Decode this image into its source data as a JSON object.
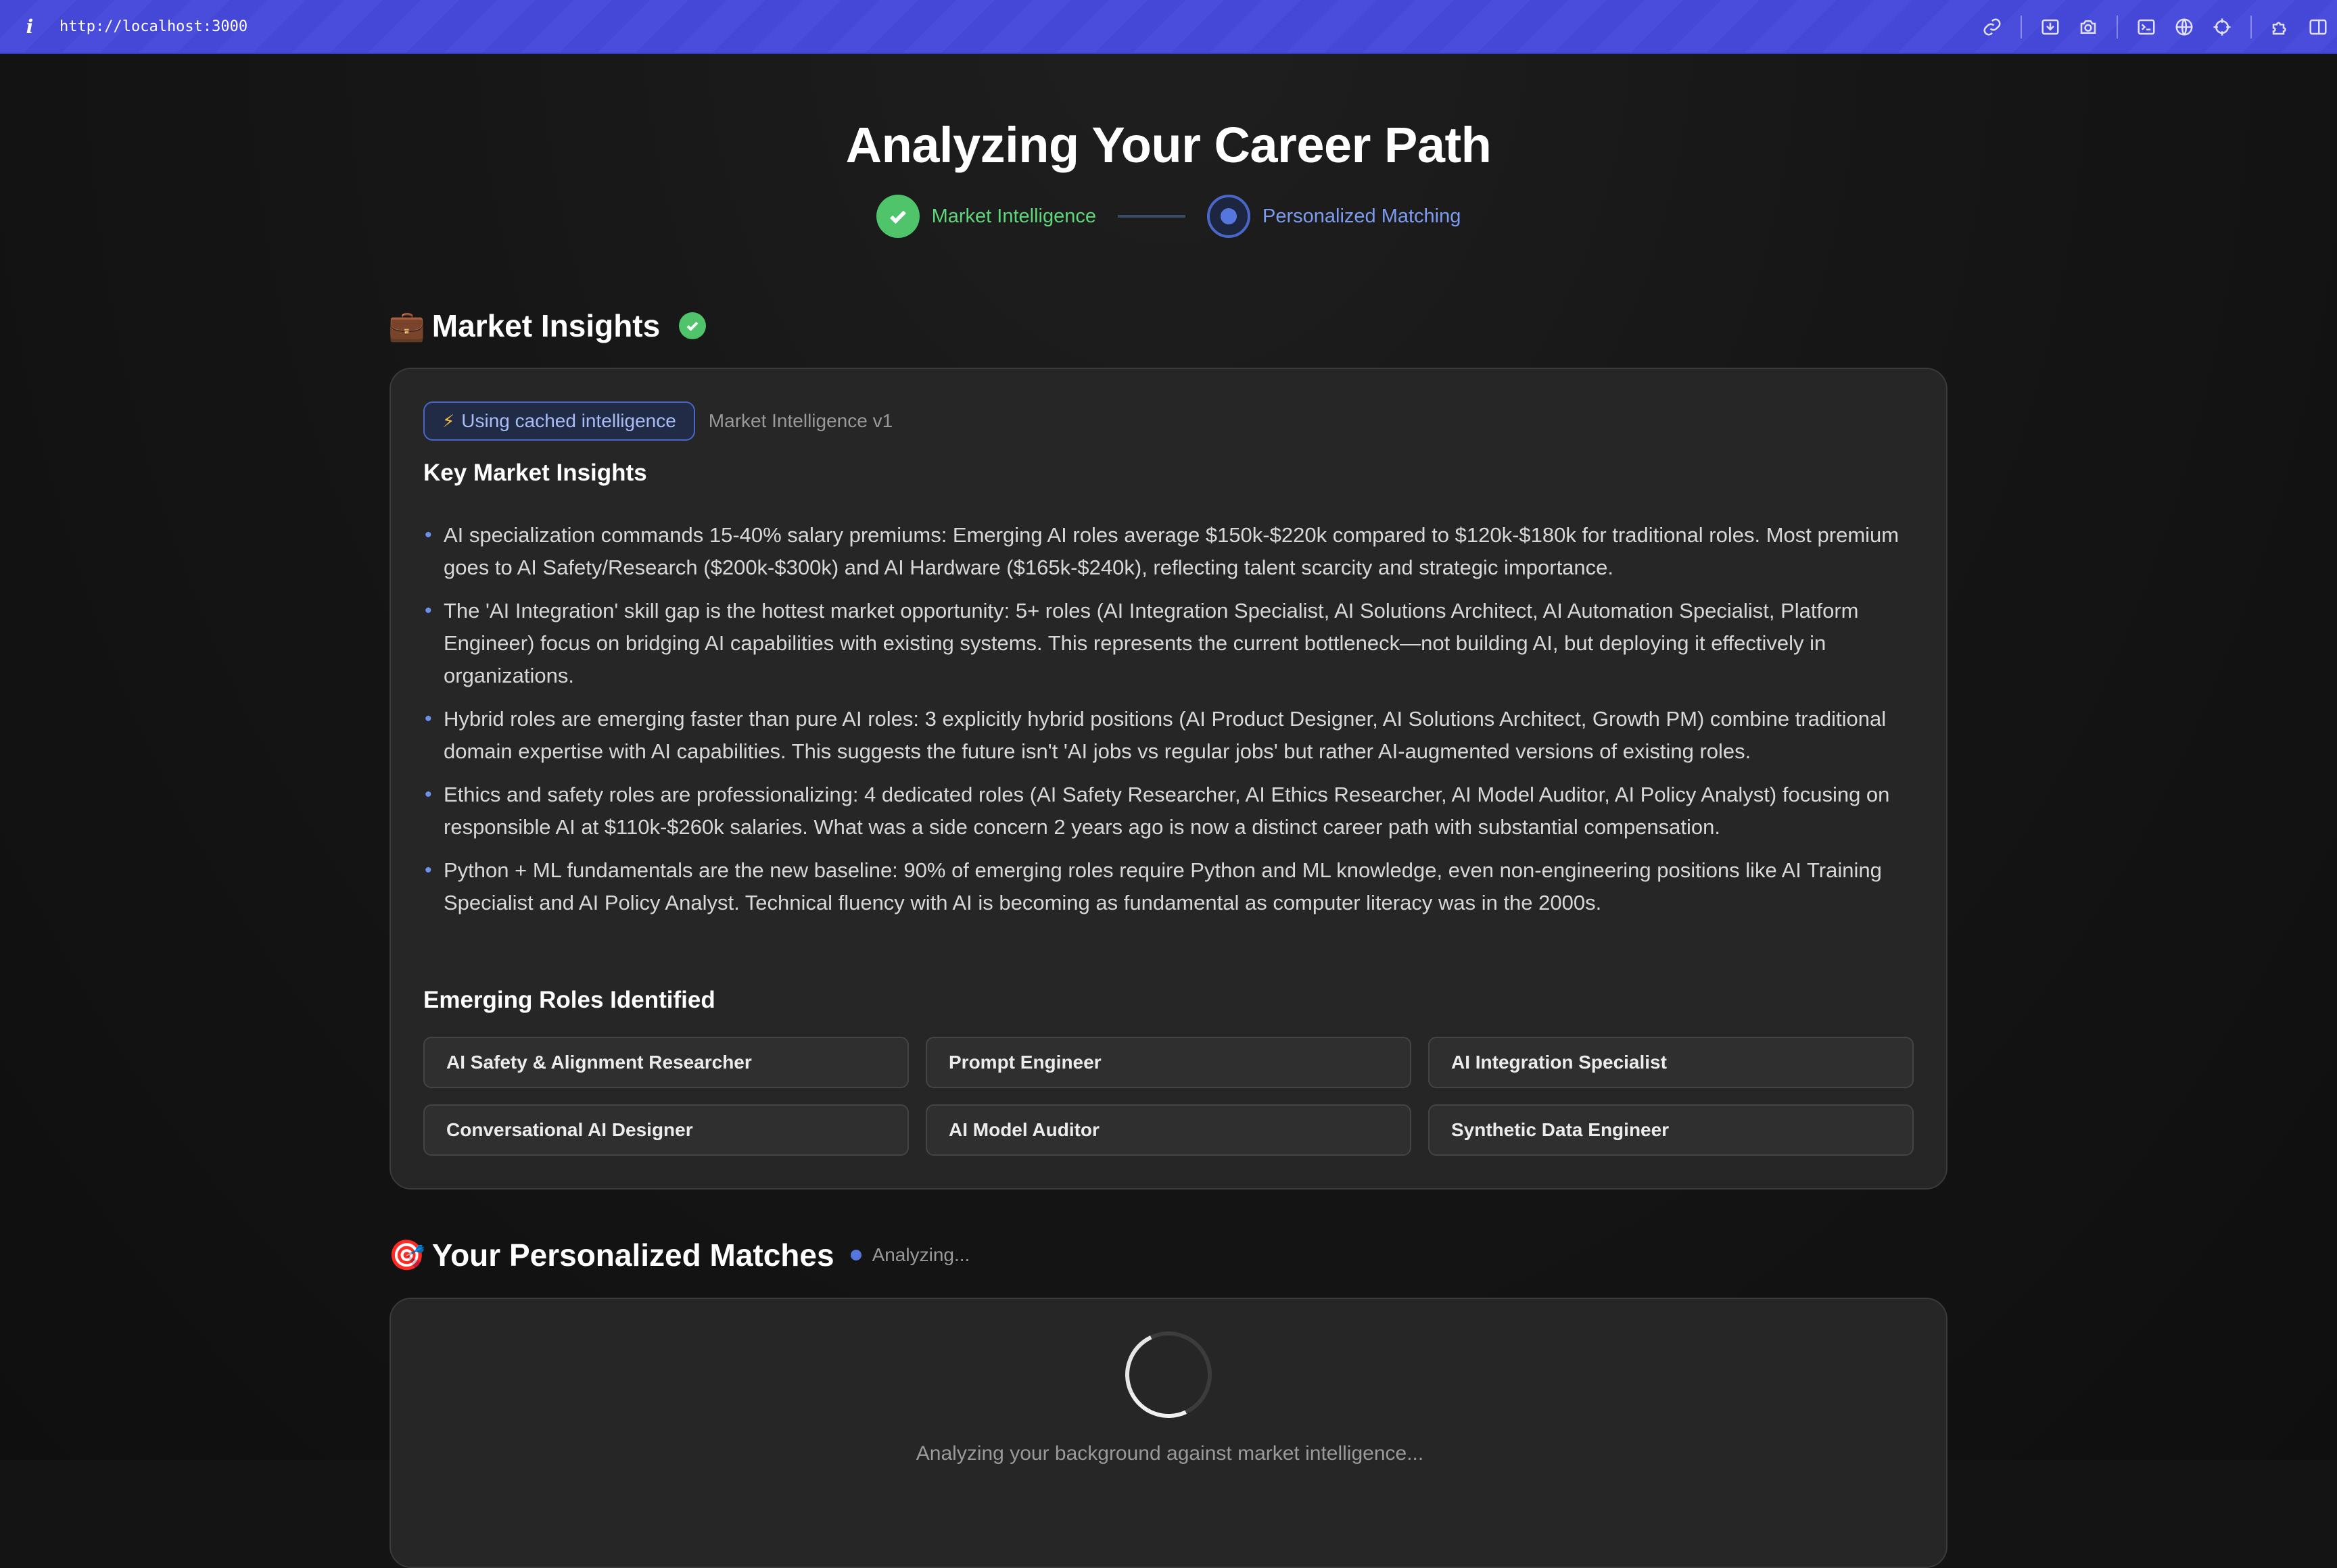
{
  "browser": {
    "info_icon": "i",
    "url": "http://localhost:3000",
    "icons": [
      "link-icon",
      "download-icon",
      "camera-icon",
      "terminal-icon",
      "globe-icon",
      "crosshair-icon",
      "extension-icon",
      "sidebar-icon"
    ]
  },
  "header": {
    "title": "Analyzing Your Career Path",
    "steps": [
      {
        "label": "Market Intelligence",
        "status": "complete"
      },
      {
        "label": "Personalized Matching",
        "status": "active"
      }
    ]
  },
  "market_insights": {
    "emoji": "💼",
    "title": "Market Insights",
    "cache_chip": "Using cached intelligence",
    "version": "Market Intelligence v1",
    "key_insights_heading": "Key Market Insights",
    "insights": [
      "AI specialization commands 15-40% salary premiums: Emerging AI roles average $150k-$220k compared to $120k-$180k for traditional roles. Most premium goes to AI Safety/Research ($200k-$300k) and AI Hardware ($165k-$240k), reflecting talent scarcity and strategic importance.",
      "The 'AI Integration' skill gap is the hottest market opportunity: 5+ roles (AI Integration Specialist, AI Solutions Architect, AI Automation Specialist, Platform Engineer) focus on bridging AI capabilities with existing systems. This represents the current bottleneck—not building AI, but deploying it effectively in organizations.",
      "Hybrid roles are emerging faster than pure AI roles: 3 explicitly hybrid positions (AI Product Designer, AI Solutions Architect, Growth PM) combine traditional domain expertise with AI capabilities. This suggests the future isn't 'AI jobs vs regular jobs' but rather AI-augmented versions of existing roles.",
      "Ethics and safety roles are professionalizing: 4 dedicated roles (AI Safety Researcher, AI Ethics Researcher, AI Model Auditor, AI Policy Analyst) focusing on responsible AI at $110k-$260k salaries. What was a side concern 2 years ago is now a distinct career path with substantial compensation.",
      "Python + ML fundamentals are the new baseline: 90% of emerging roles require Python and ML knowledge, even non-engineering positions like AI Training Specialist and AI Policy Analyst. Technical fluency with AI is becoming as fundamental as computer literacy was in the 2000s."
    ],
    "emerging_roles_heading": "Emerging Roles Identified",
    "roles": [
      "AI Safety & Alignment Researcher",
      "Prompt Engineer",
      "AI Integration Specialist",
      "Conversational AI Designer",
      "AI Model Auditor",
      "Synthetic Data Engineer"
    ]
  },
  "personalized_matches": {
    "emoji": "🎯",
    "title": "Your Personalized Matches",
    "status": "Analyzing...",
    "loading_text": "Analyzing your background against market intelligence..."
  }
}
